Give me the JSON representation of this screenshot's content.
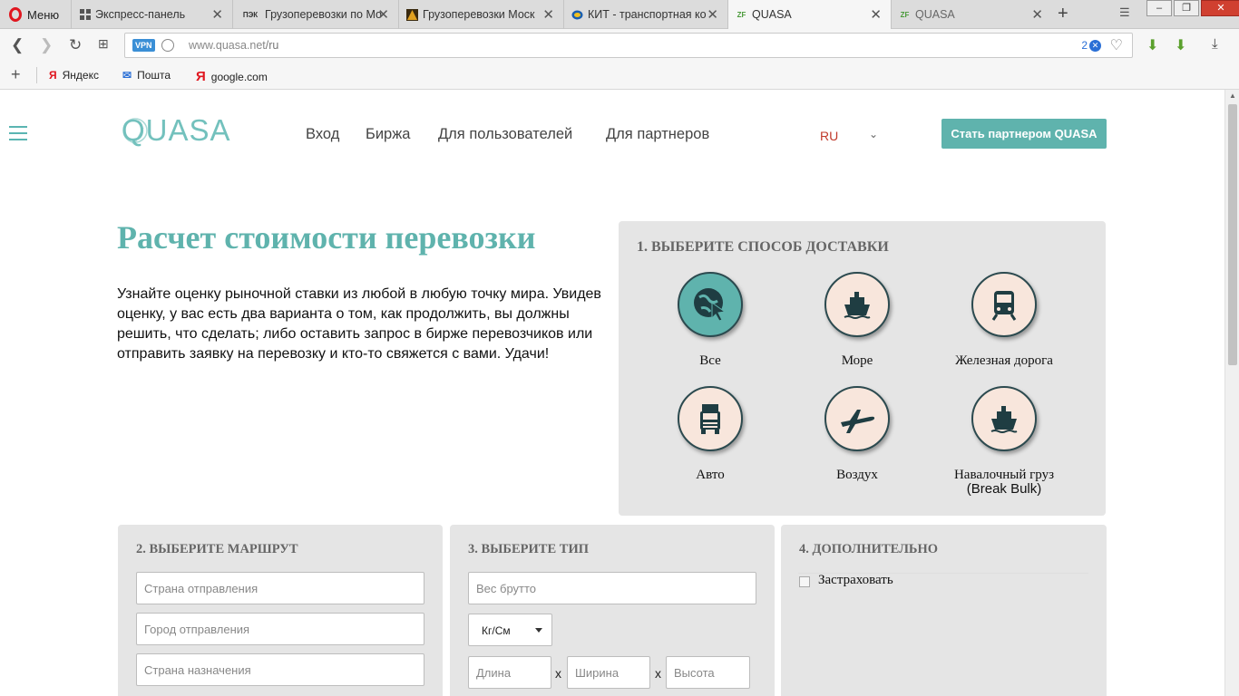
{
  "browser": {
    "menu_label": "Меню",
    "tabs": [
      {
        "label": "Экспресс-панель",
        "icon": "grid-icon"
      },
      {
        "label": "Грузоперевозки по Мо",
        "icon": "pek-icon",
        "favtext": "ПЭК"
      },
      {
        "label": "Грузоперевозки Моск",
        "icon": "triangle-icon"
      },
      {
        "label": "КИТ - транспортная ко",
        "icon": "kit-icon"
      },
      {
        "label": "QUASA",
        "icon": "quasa-icon",
        "active": true
      },
      {
        "label": "QUASA",
        "icon": "quasa-icon"
      }
    ],
    "url_host": "www.quasa.net",
    "url_path": "/ru",
    "vpn_label": "VPN",
    "adblock_count": "2",
    "bookmarks": [
      {
        "label": "Яндекс",
        "icon": "yandex-icon"
      },
      {
        "label": "Пошта",
        "icon": "mail-icon"
      },
      {
        "label": "google.com",
        "icon": "yandex-y-icon"
      }
    ]
  },
  "site": {
    "logo": "QUASA",
    "nav": [
      "Вход",
      "Биржа",
      "Для пользователей",
      "Для партнеров"
    ],
    "lang": "RU",
    "partner_button": "Стать партнером QUASA",
    "heading": "Расчет стоимости перевозки",
    "intro": "Узнайте оценку рыночной ставки из любой в любую точку мира. Увидев оценку, у вас есть два варианта о том, как продолжить, вы должны решить, что сделать; либо оставить запрос в бирже перевозчиков или отправить заявку на перевозку и кто-то свяжется с вами. Удачи!"
  },
  "delivery": {
    "title": "1. ВЫБЕРИТЕ СПОСОБ ДОСТАВКИ",
    "modes": [
      {
        "label": "Все",
        "icon": "globe-cursor-icon",
        "selected": true
      },
      {
        "label": "Море",
        "icon": "ship-icon"
      },
      {
        "label": "Железная дорога",
        "icon": "train-icon"
      },
      {
        "label": "Авто",
        "icon": "truck-icon"
      },
      {
        "label": "Воздух",
        "icon": "airplane-icon"
      },
      {
        "label": "Навалочный груз",
        "label2": "(Break Bulk)",
        "icon": "ship-icon"
      }
    ]
  },
  "route": {
    "title": "2. ВЫБЕРИТЕ МАРШРУТ",
    "origin_country": "Страна отправления",
    "origin_city": "Город отправления",
    "dest_country": "Страна назначения"
  },
  "type": {
    "title": "3. ВЫБЕРИТЕ ТИП",
    "gross_weight": "Вес брутто",
    "unit": "Кг/См",
    "length": "Длина",
    "width": "Ширина",
    "height": "Высота",
    "times": "x"
  },
  "extra": {
    "title": "4. ДОПОЛНИТЕЛЬНО",
    "insure": "Застраховать"
  },
  "colors": {
    "accent": "#5fb3ad",
    "lang": "#c0392b",
    "panel": "#e5e5e5"
  }
}
